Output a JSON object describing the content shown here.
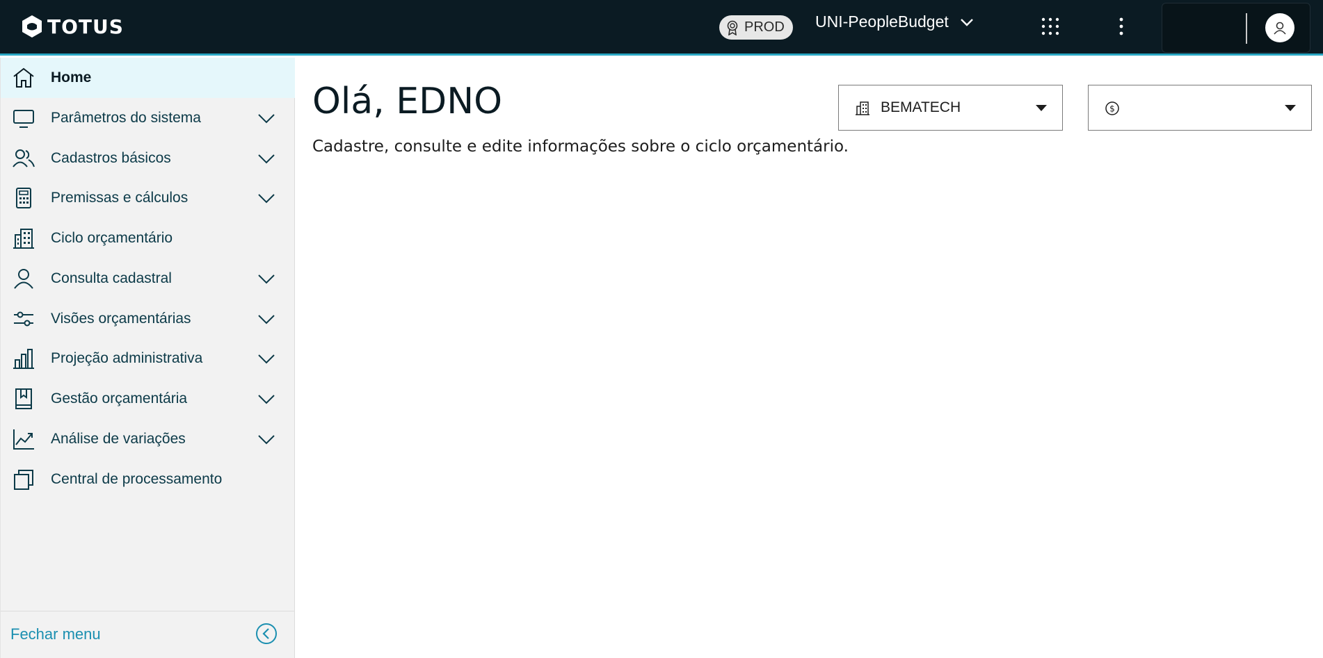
{
  "header": {
    "brand": "TOTUS",
    "environment": "PROD",
    "app_name": "UNI-PeopleBudget",
    "icons": {
      "environment": "award-icon",
      "app_switch": "chevron-down-icon",
      "apps": "apps-grid-icon",
      "more": "kebab-menu-icon",
      "user": "user-avatar-icon"
    }
  },
  "sidebar": {
    "items": [
      {
        "label": "Home",
        "icon": "home-icon",
        "expandable": false,
        "active": true
      },
      {
        "label": "Parâmetros do sistema",
        "icon": "monitor-icon",
        "expandable": true
      },
      {
        "label": "Cadastros básicos",
        "icon": "users-icon",
        "expandable": true
      },
      {
        "label": "Premissas e cálculos",
        "icon": "calculator-icon",
        "expandable": true
      },
      {
        "label": "Ciclo orçamentário",
        "icon": "buildings-icon",
        "expandable": false
      },
      {
        "label": "Consulta cadastral",
        "icon": "user-icon",
        "expandable": true
      },
      {
        "label": "Visões orçamentárias",
        "icon": "sliders-icon",
        "expandable": true
      },
      {
        "label": "Projeção administrativa",
        "icon": "bar-chart-icon",
        "expandable": true
      },
      {
        "label": "Gestão orçamentária",
        "icon": "bookmark-book-icon",
        "expandable": true
      },
      {
        "label": "Análise de variações",
        "icon": "trend-chart-icon",
        "expandable": true
      },
      {
        "label": "Central de processamento",
        "icon": "stacked-windows-icon",
        "expandable": false
      }
    ],
    "footer": {
      "label": "Fechar menu",
      "icon": "chevron-left-circle-icon"
    }
  },
  "main": {
    "greeting": "Olá, EDNO",
    "subtitle": "Cadastre, consulte e edite informações sobre o ciclo orçamentário.",
    "company_select": {
      "value": "BEMATECH",
      "icon": "building-icon"
    },
    "currency_select": {
      "value": "",
      "icon": "currency-coin-icon"
    }
  },
  "colors": {
    "header_bg": "#0b1b23",
    "header_accent": "#2aa7c4",
    "sidebar_bg": "#f2f2f2",
    "active_item_bg": "#e5f7fb",
    "nav_text": "#0c3a48",
    "link": "#1b8fb0"
  }
}
